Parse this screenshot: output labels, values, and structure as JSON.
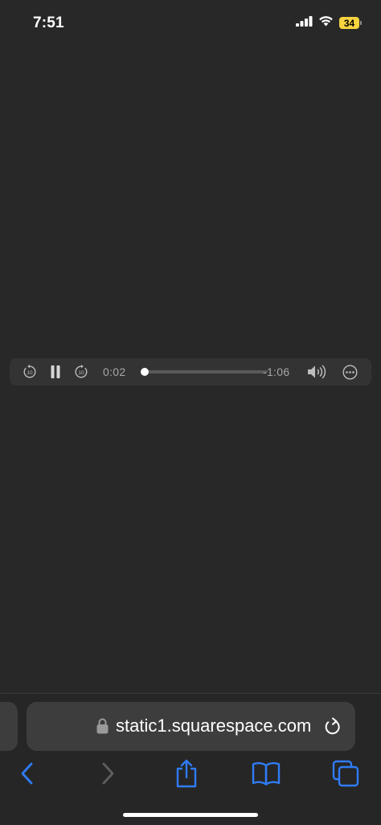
{
  "status_bar": {
    "time": "7:51",
    "battery_level": "34",
    "battery_color": "#f5d33f",
    "icons": [
      "cellular-signal-icon",
      "wifi-icon",
      "battery-icon"
    ]
  },
  "audio_player": {
    "current_time": "0:02",
    "remaining_time": "-1:06",
    "progress_fraction": 0.03,
    "skip_back_seconds": "10",
    "skip_forward_seconds": "10",
    "playing": true,
    "icons": [
      "skip-back-10-icon",
      "pause-icon",
      "skip-forward-10-icon",
      "volume-icon",
      "more-options-icon"
    ]
  },
  "browser": {
    "url": "static1.squarespace.com",
    "secure": true,
    "accent_color": "#2f7cf6",
    "toolbar_icons": [
      "back-icon",
      "forward-icon",
      "share-icon",
      "bookmarks-icon",
      "tabs-icon"
    ]
  }
}
